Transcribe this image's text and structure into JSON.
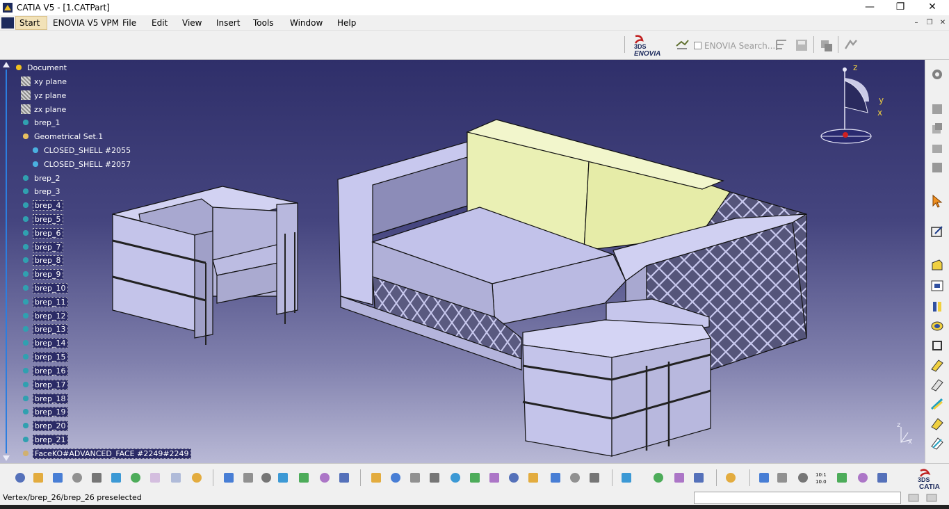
{
  "window": {
    "title": "CATIA V5 - [1.CATPart]",
    "minimize": "—",
    "restore": "❐",
    "close": "✕"
  },
  "menubar": {
    "items": [
      "Start",
      "ENOVIA V5 VPM",
      "File",
      "Edit",
      "View",
      "Insert",
      "Tools",
      "Window",
      "Help"
    ],
    "doc_min": "–",
    "doc_restore": "❐",
    "doc_close": "✕"
  },
  "toolbar_top": {
    "enovia_brand": "ENOVIA",
    "enovia_brand_prefix": "3DS",
    "enovia_search": "ENOVIA Search..."
  },
  "tree": {
    "items": [
      {
        "label": "Document",
        "icon": "document-icon"
      },
      {
        "label": "xy plane",
        "icon": "plane-icon"
      },
      {
        "label": "yz plane",
        "icon": "plane-icon"
      },
      {
        "label": "zx plane",
        "icon": "plane-icon"
      },
      {
        "label": "brep_1",
        "icon": "brep-icon"
      },
      {
        "label": "Geometrical Set.1",
        "icon": "geometrical-set-icon"
      },
      {
        "label": "CLOSED_SHELL #2055",
        "icon": "shell-icon"
      },
      {
        "label": "CLOSED_SHELL #2057",
        "icon": "shell-icon"
      },
      {
        "label": "brep_2",
        "icon": "brep-icon"
      },
      {
        "label": "brep_3",
        "icon": "brep-icon"
      },
      {
        "label": "brep_4",
        "icon": "brep-icon"
      },
      {
        "label": "brep_5",
        "icon": "brep-icon"
      },
      {
        "label": "brep_6",
        "icon": "brep-icon"
      },
      {
        "label": "brep_7",
        "icon": "brep-icon"
      },
      {
        "label": "brep_8",
        "icon": "brep-icon"
      },
      {
        "label": "brep_9",
        "icon": "brep-icon"
      },
      {
        "label": "brep_10",
        "icon": "brep-icon"
      },
      {
        "label": "brep_11",
        "icon": "brep-icon"
      },
      {
        "label": "brep_12",
        "icon": "brep-icon"
      },
      {
        "label": "brep_13",
        "icon": "brep-icon"
      },
      {
        "label": "brep_14",
        "icon": "brep-icon"
      },
      {
        "label": "brep_15",
        "icon": "brep-icon"
      },
      {
        "label": "brep_16",
        "icon": "brep-icon"
      },
      {
        "label": "brep_17",
        "icon": "brep-icon"
      },
      {
        "label": "brep_18",
        "icon": "brep-icon"
      },
      {
        "label": "brep_19",
        "icon": "brep-icon"
      },
      {
        "label": "brep_20",
        "icon": "brep-icon"
      },
      {
        "label": "brep_21",
        "icon": "brep-icon"
      },
      {
        "label": "FaceKO#ADVANCED_FACE #2249#2249",
        "icon": "face-ko-icon"
      }
    ]
  },
  "compass": {
    "z": "z",
    "y": "y",
    "x": "x"
  },
  "axis_triad": {
    "z": "z",
    "x": "x"
  },
  "bottom_brand": {
    "prefix": "3DS",
    "name": "CATIA"
  },
  "zoom_label": {
    "top": "10:1",
    "bottom": "10.0"
  },
  "statusbar": {
    "text": "Vertex/brep_26/brep_26 preselected",
    "command_value": ""
  },
  "colors": {
    "viewport_top": "#2f2f6a",
    "viewport_bottom": "#b9b9d6",
    "model_face": "#c8c8ee",
    "cushion": "#e8eeae"
  }
}
